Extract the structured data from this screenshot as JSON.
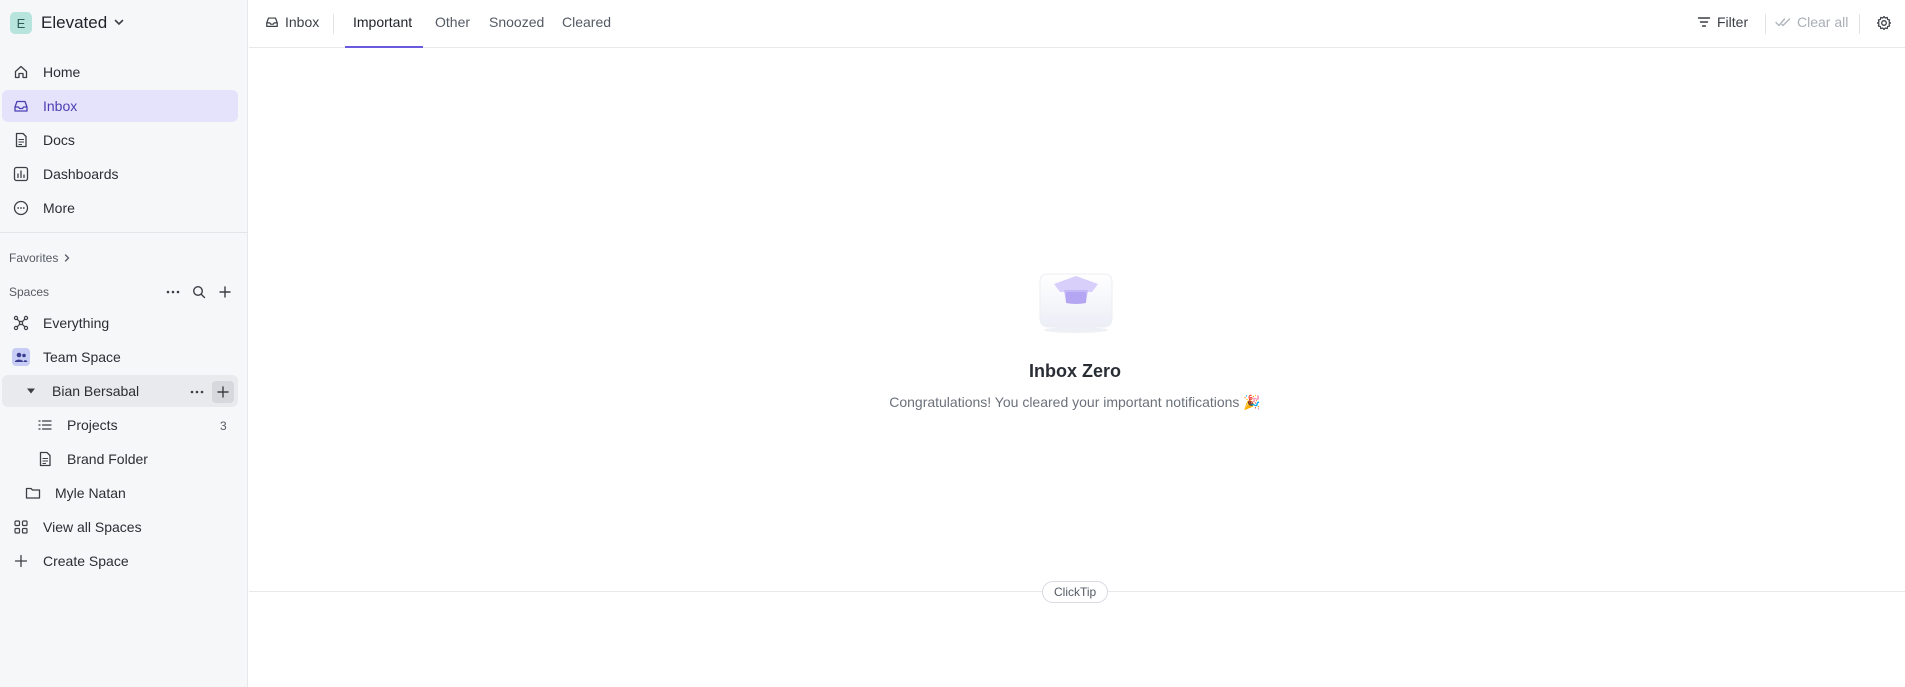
{
  "workspace": {
    "initial": "E",
    "name": "Elevated"
  },
  "nav": {
    "home": "Home",
    "inbox": "Inbox",
    "docs": "Docs",
    "dashboards": "Dashboards",
    "more": "More"
  },
  "favorites_label": "Favorites",
  "spaces": {
    "label": "Spaces",
    "everything": "Everything",
    "team_space": "Team Space",
    "bian": "Bian Bersabal",
    "projects": {
      "label": "Projects",
      "count": "3"
    },
    "brand_folder": "Brand Folder",
    "myle": "Myle Natan",
    "view_all": "View all Spaces",
    "create": "Create Space"
  },
  "topbar": {
    "breadcrumb": "Inbox",
    "tabs": [
      "Important",
      "Other",
      "Snoozed",
      "Cleared"
    ],
    "active_tab": "Important",
    "filter": "Filter",
    "clear_all": "Clear all"
  },
  "empty_state": {
    "title": "Inbox Zero",
    "subtitle": "Congratulations! You cleared your important notifications 🎉"
  },
  "clicktip": "ClickTip",
  "colors": {
    "accent": "#6a5ae0",
    "active_bg": "#e5e2fb",
    "sidebar_bg": "#f6f7f9"
  }
}
